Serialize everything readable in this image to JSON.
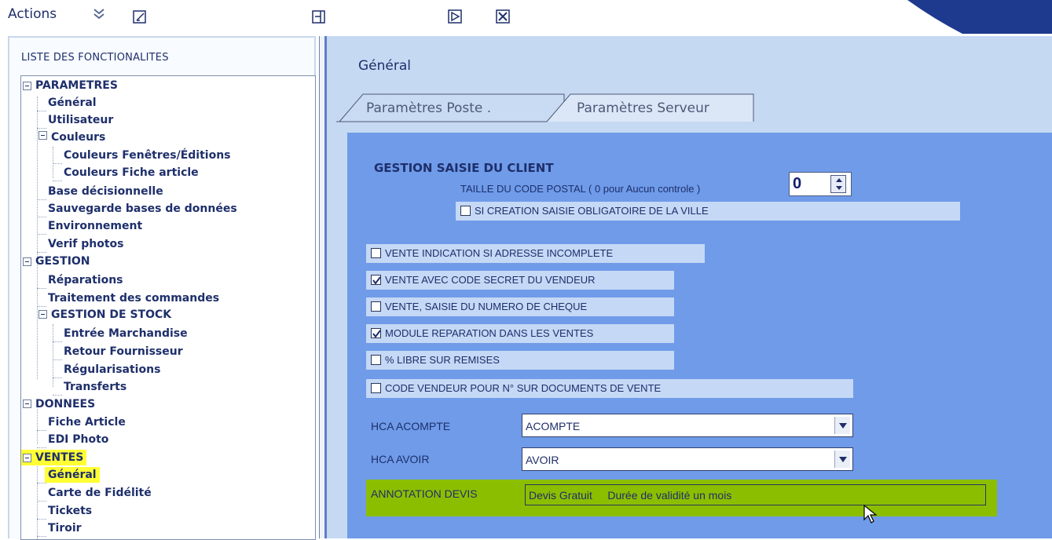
{
  "toolbar": {
    "actions_label": "Actions"
  },
  "left_panel": {
    "title": "LISTE DES FONCTIONALITES",
    "tree": {
      "parametres": "PARAMETRES",
      "general": "Général",
      "utilisateur": "Utilisateur",
      "couleurs": "Couleurs",
      "couleurs_fenetres": "Couleurs Fenêtres/Éditions",
      "couleurs_fiche": "Couleurs Fiche article",
      "base_decisionnelle": "Base décisionnelle",
      "sauvegarde": "Sauvegarde bases de données",
      "environnement": "Environnement",
      "verif_photos": "Verif photos",
      "gestion": "GESTION",
      "reparations": "Réparations",
      "traitement": "Traitement des commandes",
      "gestion_stock": "GESTION DE STOCK",
      "entree": "Entrée Marchandise",
      "retour": "Retour Fournisseur",
      "regularisations": "Régularisations",
      "transferts": "Transferts",
      "donnees": "DONNEES",
      "fiche_article": "Fiche Article",
      "edi_photo": "EDI Photo",
      "ventes": "VENTES",
      "ventes_general": "Général",
      "carte_fidelite": "Carte de Fidélité",
      "tickets": "Tickets",
      "tiroir": "Tiroir"
    }
  },
  "main": {
    "title": "Général",
    "tabs": [
      {
        "label": "Paramètres Poste ."
      },
      {
        "label": "Paramètres Serveur"
      }
    ],
    "section_title": "GESTION SAISIE DU CLIENT",
    "postal_label": "TAILLE DU CODE POSTAL ( 0  pour Aucun controle )",
    "postal_value": "0",
    "checkboxes": {
      "creation_ville": "SI CREATION  SAISIE  OBLIGATOIRE DE LA VILLE",
      "adresse_incomplete": "VENTE INDICATION SI ADRESSE INCOMPLETE",
      "code_secret": "VENTE AVEC CODE SECRET DU VENDEUR",
      "numero_cheque": "VENTE, SAISIE DU NUMERO DE CHEQUE",
      "module_reparation": "MODULE REPARATION DANS LES VENTES",
      "libre_remises": "% LIBRE SUR REMISES",
      "code_vendeur": "CODE VENDEUR POUR N° SUR DOCUMENTS DE VENTE"
    },
    "checked": {
      "creation_ville": false,
      "adresse_incomplete": false,
      "code_secret": true,
      "numero_cheque": false,
      "module_reparation": true,
      "libre_remises": false,
      "code_vendeur": false
    },
    "hca_acompte_label": "HCA ACOMPTE",
    "hca_acompte_value": "ACOMPTE",
    "hca_avoir_label": "HCA AVOIR",
    "hca_avoir_value": "AVOIR",
    "annotation_label": "ANNOTATION DEVIS",
    "annotation_value": "Devis Gratuit     Durée de validité un mois"
  },
  "colors": {
    "panel_blue": "#6f9be9",
    "highlight_yellow": "#ffff33",
    "annotation_green": "#8cbe00"
  }
}
